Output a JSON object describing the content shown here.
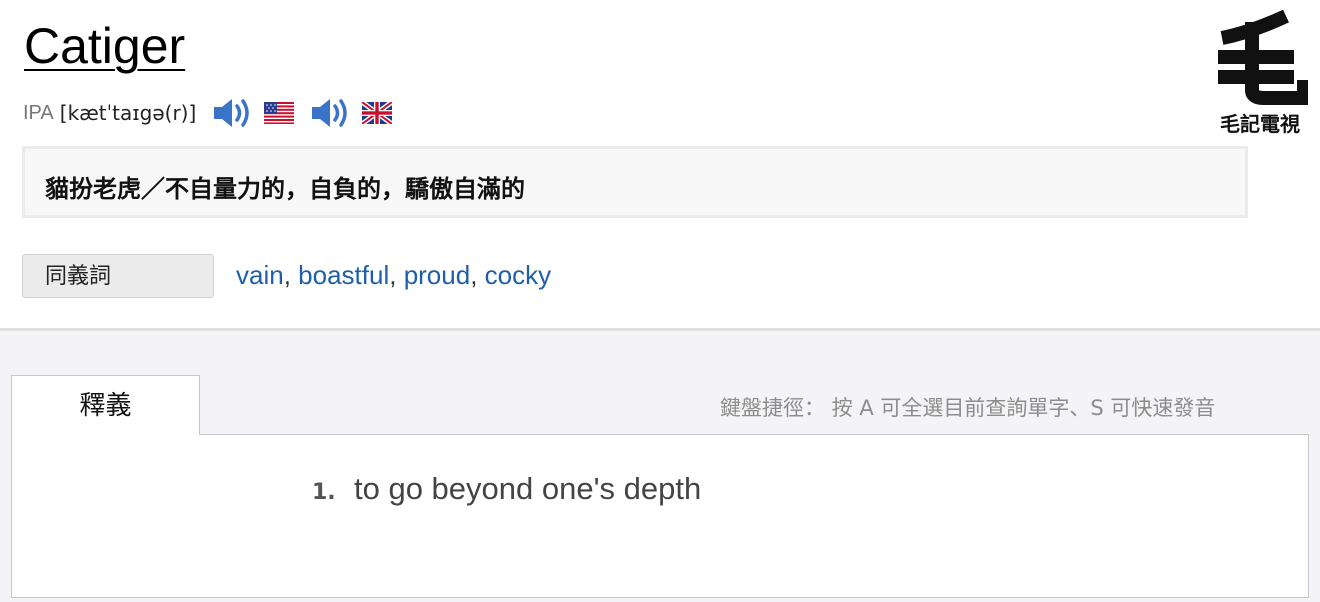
{
  "word": {
    "title": "Catiger",
    "ipa_label": "IPA",
    "ipa": "[kætˈtaɪgə(r)]"
  },
  "audio": [
    {
      "icon": "speaker-icon",
      "flag": "us-flag-icon"
    },
    {
      "icon": "speaker-icon",
      "flag": "uk-flag-icon"
    }
  ],
  "logo": {
    "caption": "毛記電視"
  },
  "definition": {
    "zh": "貓扮老虎／不自量力的，自負的，驕傲自滿的"
  },
  "synonyms": {
    "label": "同義詞",
    "items": [
      "vain",
      "boastful",
      "proud",
      "cocky"
    ],
    "separator": ", "
  },
  "tabs": {
    "active": "釋義"
  },
  "shortcut_hint": "鍵盤捷徑： 按 A 可全選目前查詢單字、S 可快速發音",
  "meanings": [
    {
      "num": "1.",
      "text": "to go beyond one's depth"
    }
  ],
  "colors": {
    "link": "#1f5ea8",
    "speaker": "#3a73c8"
  }
}
